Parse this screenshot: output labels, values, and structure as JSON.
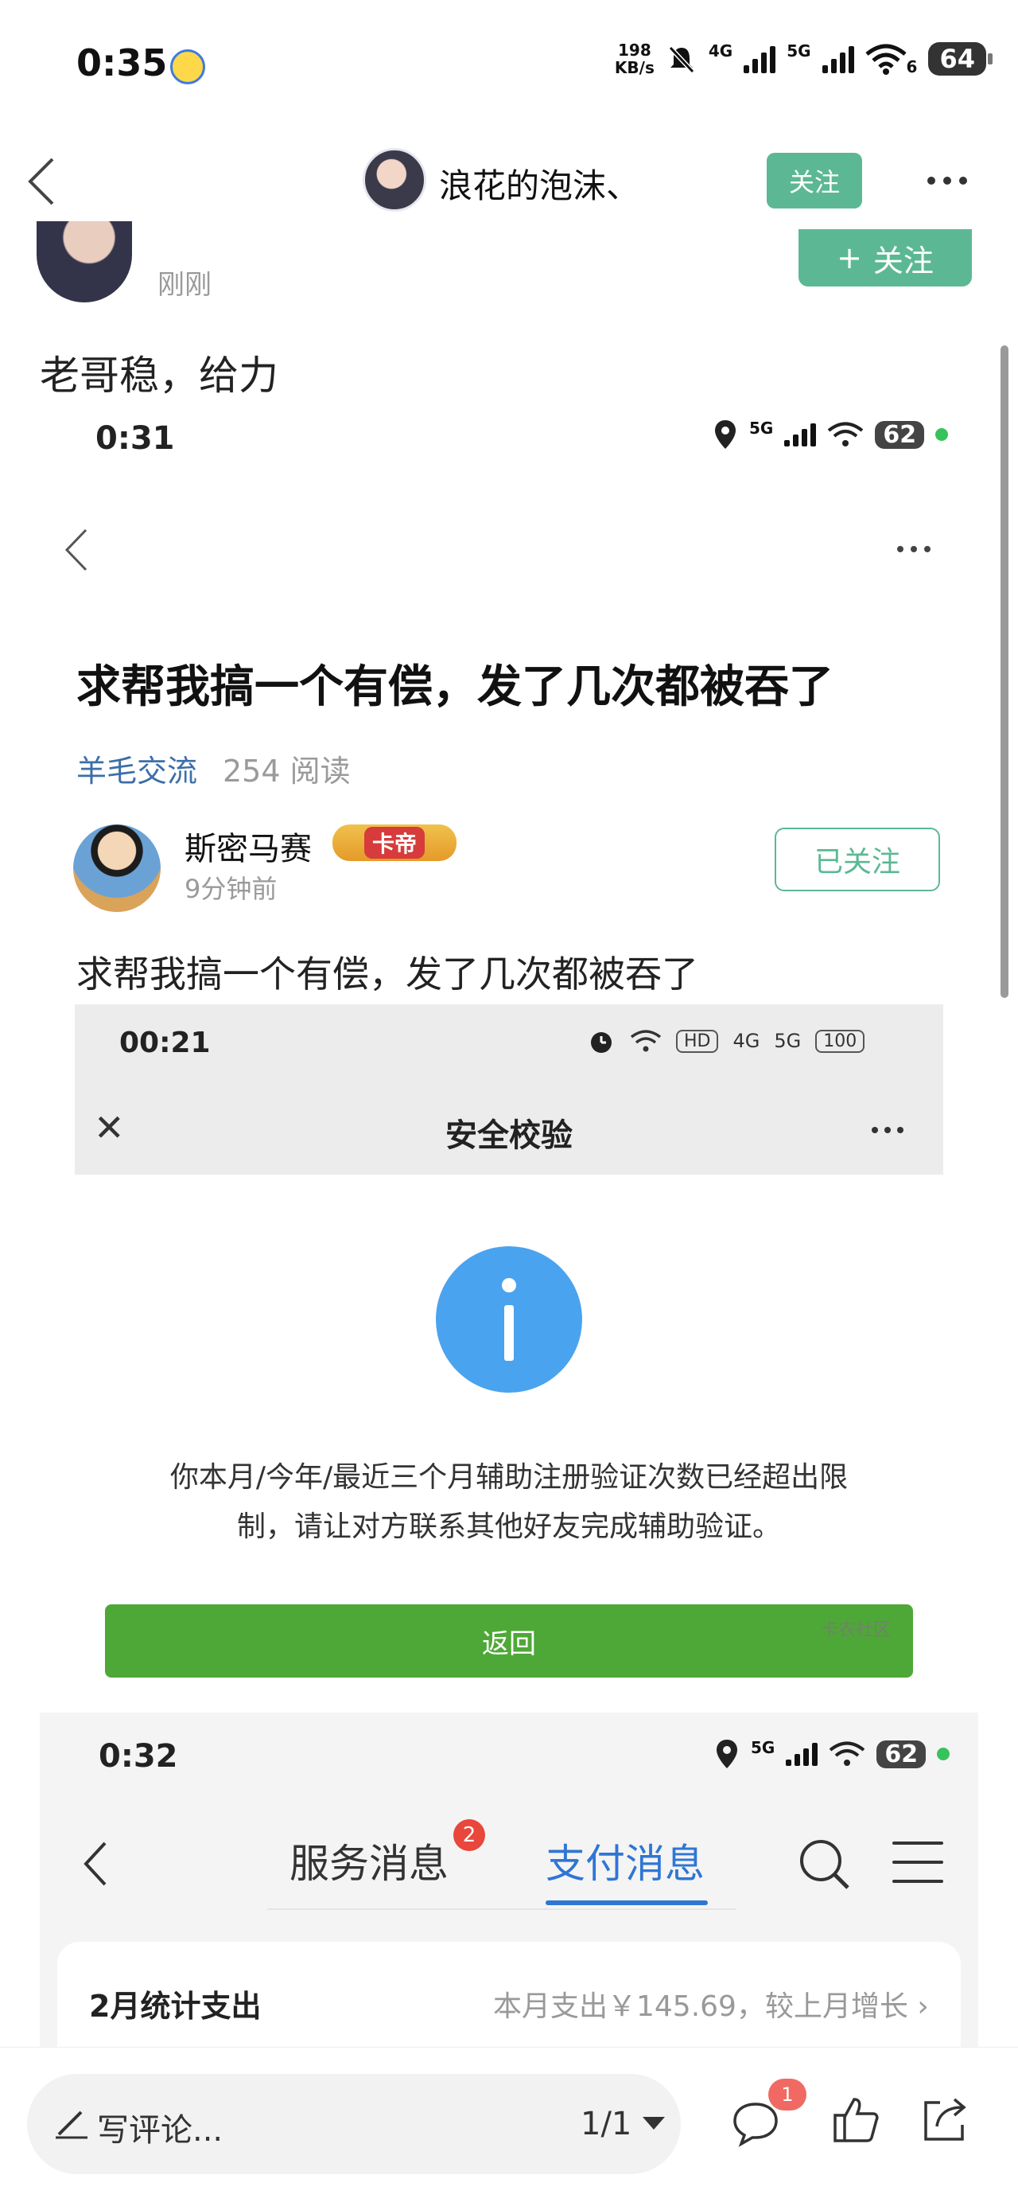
{
  "status_bar": {
    "time": "0:35",
    "net_speed_value": "198",
    "net_speed_unit": "KB/s",
    "sig1_label": "4G",
    "sig2_label": "5G",
    "wifi_sub": "6",
    "battery": "64"
  },
  "top_nav": {
    "user_name": "浪花的泡沫、",
    "follow_label": "关注"
  },
  "post": {
    "time": "刚刚",
    "follow_label": "关注",
    "text": "老哥稳，给力"
  },
  "embedded_1": {
    "status": {
      "time": "0:31",
      "signal": "5G",
      "battery": "62"
    },
    "title": "求帮我搞一个有偿，发了几次都被吞了",
    "category": "羊毛交流",
    "reads": "254 阅读",
    "author": "斯密马赛",
    "badge": "卡帝",
    "time_ago": "9分钟前",
    "followed_label": "已关注",
    "body": "求帮我搞一个有偿，发了几次都被吞了"
  },
  "embedded_2": {
    "status": {
      "time": "00:21",
      "hd": "HD",
      "sig1": "4G",
      "sig2": "5G",
      "battery": "100"
    },
    "title": "安全校验",
    "message_line1": "你本月/今年/最近三个月辅助注册验证次数已经超出限",
    "message_line2": "制，请让对方联系其他好友完成辅助验证。",
    "button": "返回",
    "watermark": "卡农社区"
  },
  "embedded_3": {
    "status": {
      "time": "0:32",
      "signal": "5G",
      "battery": "62"
    },
    "tab_service": "服务消息",
    "tab_service_badge": "2",
    "tab_pay": "支付消息",
    "card_title": "2月统计支出",
    "card_summary": "本月支出￥145.69，较上月增长"
  },
  "bottom_bar": {
    "comment_placeholder": "写评论...",
    "page_indicator": "1/1",
    "comment_badge": "1"
  },
  "colors": {
    "follow_green": "#5cb894",
    "link_blue": "#3d6ea8",
    "info_blue": "#4aa3ef",
    "button_green": "#4ea837",
    "tab_blue": "#2f76d3",
    "badge_red": "#e9463c"
  }
}
